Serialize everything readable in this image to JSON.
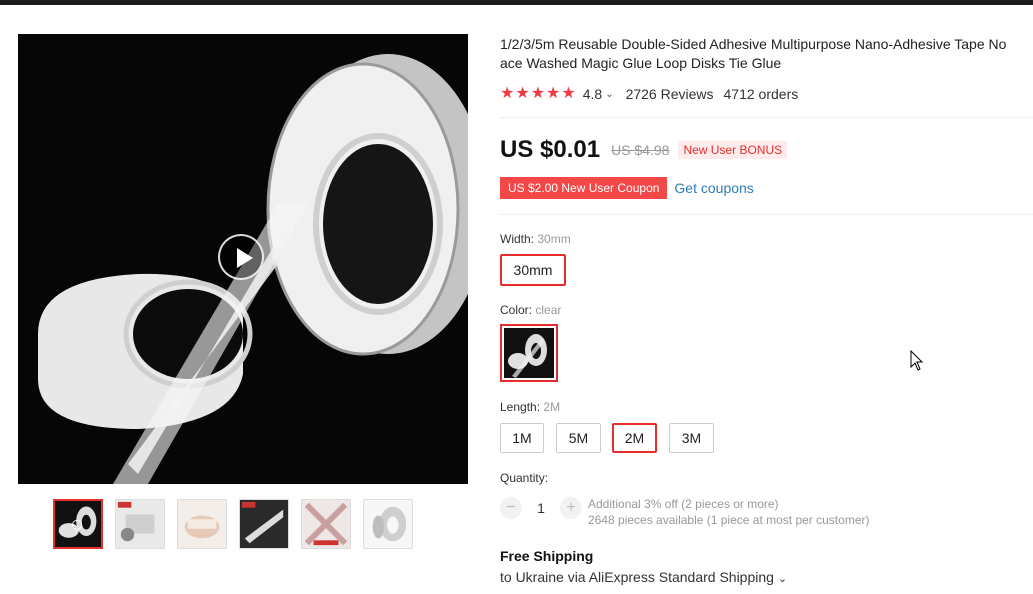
{
  "product": {
    "title": "1/2/3/5m Reusable Double-Sided Adhesive Multipurpose Nano-Adhesive Tape No\nace Washed Magic Glue Loop Disks Tie Glue",
    "rating": "4.8",
    "rating_stars": 5,
    "reviews": "2726 Reviews",
    "orders": "4712 orders"
  },
  "pricing": {
    "price": "US $0.01",
    "old_price": "US $4.98",
    "bonus_badge": "New User BONUS",
    "coupon": "US $2.00 New User Coupon",
    "get_coupons": "Get coupons"
  },
  "options": {
    "width": {
      "label": "Width:",
      "value": "30mm",
      "choices": [
        "30mm"
      ]
    },
    "color": {
      "label": "Color:",
      "value": "clear"
    },
    "length": {
      "label": "Length:",
      "value": "2M",
      "choices": [
        "1M",
        "5M",
        "2M",
        "3M"
      ]
    }
  },
  "quantity": {
    "label": "Quantity:",
    "minus": "−",
    "plus": "+",
    "value": "1",
    "discount_note": "Additional 3% off (2 pieces or more)",
    "available_note": "2648 pieces available (1 piece at most per customer)"
  },
  "shipping": {
    "title": "Free Shipping",
    "destination": "to Ukraine via AliExpress Standard Shipping",
    "caret": "⌄"
  },
  "colors": {
    "accent": "#e62e2e",
    "star": "#f03c45",
    "coupon_bg": "#f44848",
    "link": "#2e7db4"
  }
}
